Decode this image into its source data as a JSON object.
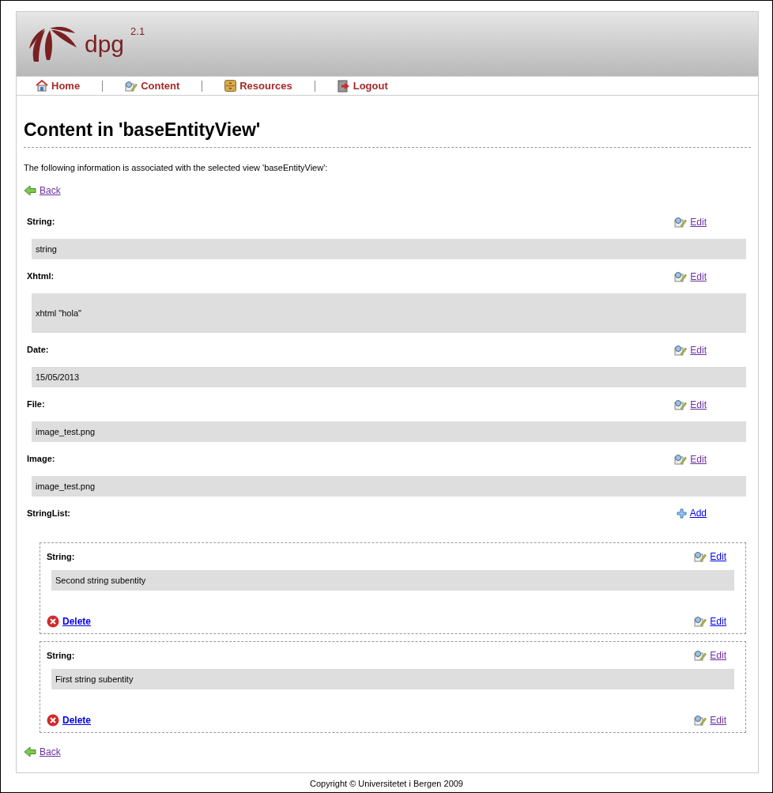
{
  "logo": {
    "name": "dpg",
    "version": "2.1"
  },
  "nav": [
    {
      "label": "Home",
      "kind": "home"
    },
    {
      "label": "Content",
      "kind": "content"
    },
    {
      "label": "Resources",
      "kind": "resources"
    },
    {
      "label": "Logout",
      "kind": "logout"
    }
  ],
  "title": "Content in 'baseEntityView'",
  "intro": "The following information is associated with the selected view 'baseEntityView':",
  "back_top": {
    "label": "Back",
    "visited": true
  },
  "fields": [
    {
      "label": "String:",
      "value": "string",
      "tall": false,
      "action": {
        "kind": "edit",
        "label": "Edit",
        "visited": true
      }
    },
    {
      "label": "Xhtml:",
      "value": "xhtml \"hola\"",
      "tall": true,
      "action": {
        "kind": "edit",
        "label": "Edit",
        "visited": true
      }
    },
    {
      "label": "Date:",
      "value": "15/05/2013",
      "tall": false,
      "action": {
        "kind": "edit",
        "label": "Edit",
        "visited": true
      }
    },
    {
      "label": "File:",
      "value": "image_test.png",
      "tall": false,
      "action": {
        "kind": "edit",
        "label": "Edit",
        "visited": true
      }
    },
    {
      "label": "Image:",
      "value": "image_test.png",
      "tall": false,
      "action": {
        "kind": "edit",
        "label": "Edit",
        "visited": true
      }
    }
  ],
  "list": {
    "label": "StringList:",
    "action": {
      "kind": "add",
      "label": "Add",
      "visited": false
    },
    "items": [
      {
        "label": "String:",
        "value": "Second string subentity",
        "edit_top": {
          "label": "Edit",
          "visited": false
        },
        "delete": {
          "label": "Delete",
          "visited": false
        },
        "edit_bottom": {
          "label": "Edit",
          "visited": false
        }
      },
      {
        "label": "String:",
        "value": "First string subentity",
        "edit_top": {
          "label": "Edit",
          "visited": true
        },
        "delete": {
          "label": "Delete",
          "visited": false
        },
        "edit_bottom": {
          "label": "Edit",
          "visited": true
        }
      }
    ]
  },
  "back_bottom": {
    "label": "Back",
    "visited": true
  },
  "footer": "Copyright © Universitetet i Bergen 2009"
}
